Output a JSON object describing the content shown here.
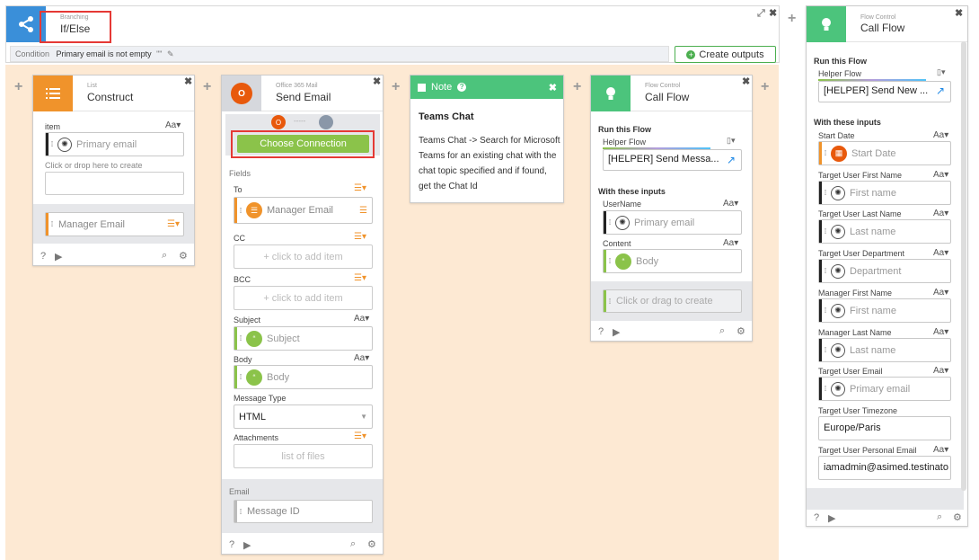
{
  "colors": {
    "canvas": "#fde9d3",
    "branch_blue": "#3a8fd9",
    "list_orange": "#f0932b",
    "mail_gray": "#d6d8dd",
    "note_green": "#4cc47c",
    "flow_green": "#4cc47c",
    "connect_green": "#8bc34a",
    "highlight_red": "#e53935",
    "link_blue": "#1e88e5"
  },
  "header": {
    "category": "Branching",
    "title": "If/Else",
    "condition_label": "Condition",
    "condition_text": "Primary email is not empty",
    "condition_suffix": "\"\"",
    "create_outputs_label": "Create outputs",
    "expand_glyph": "⤢",
    "close_glyph": "✖"
  },
  "construct": {
    "category": "List",
    "title": "Construct",
    "item_label": "item",
    "aa": "Aa",
    "item_value": "Primary email",
    "drop_hint": "Click or drop here to create",
    "manager_value": "Manager Email"
  },
  "send_email": {
    "category": "Office 365 Mail",
    "title": "Send Email",
    "connect_dashes": "-----",
    "choose_connection": "Choose Connection",
    "fields_label": "Fields",
    "to_label": "To",
    "to_value": "Manager Email",
    "cc_label": "CC",
    "cc_placeholder": "+ click to add item",
    "bcc_label": "BCC",
    "bcc_placeholder": "+ click to add item",
    "subject_label": "Subject",
    "subject_value": "Subject",
    "body_label": "Body",
    "body_value": "Body",
    "message_type_label": "Message Type",
    "message_type_value": "HTML",
    "attachments_label": "Attachments",
    "attachments_placeholder": "list of files",
    "email_label": "Email",
    "message_id_placeholder": "Message ID",
    "aa": "Aa"
  },
  "note": {
    "label": "Note",
    "heading": "Teams Chat",
    "body": "Teams Chat -> Search for Microsoft Teams for an existing chat with the chat topic specified and if found, get the Chat Id"
  },
  "call_flow": {
    "category": "Flow Control",
    "title": "Call Flow",
    "run_label": "Run this Flow",
    "helper_label": "Helper Flow",
    "helper_value": "[HELPER] Send Messa...",
    "inputs_label": "With these inputs",
    "username_label": "UserName",
    "username_value": "Primary email",
    "content_label": "Content",
    "content_value": "Body",
    "create_hint": "Click or drag to create",
    "aa": "Aa"
  },
  "pane": {
    "category": "Flow Control",
    "title": "Call Flow",
    "run_label": "Run this Flow",
    "helper_label": "Helper Flow",
    "helper_value": "[HELPER] Send New ...",
    "inputs_label": "With these inputs",
    "aa": "Aa",
    "rows": [
      {
        "label": "Start Date",
        "value": "Start Date",
        "badge": "calendar"
      },
      {
        "label": "Target User First Name",
        "value": "First name",
        "badge": "dark"
      },
      {
        "label": "Target User Last Name",
        "value": "Last name",
        "badge": "dark"
      },
      {
        "label": "Target User Department",
        "value": "Department",
        "badge": "dark"
      },
      {
        "label": "Manager First Name",
        "value": "First name",
        "badge": "dark"
      },
      {
        "label": "Manager Last Name",
        "value": "Last name",
        "badge": "dark"
      },
      {
        "label": "Target User Email",
        "value": "Primary email",
        "badge": "dark"
      }
    ],
    "timezone_label": "Target User Timezone",
    "timezone_value": "Europe/Paris",
    "personal_email_label": "Target User Personal Email",
    "personal_email_value": "iamadmin@asimed.testinato"
  },
  "footer": {
    "help_glyph": "?",
    "run_glyph": "▶",
    "search_glyph": "⌕",
    "settings_glyph": "⚙"
  }
}
